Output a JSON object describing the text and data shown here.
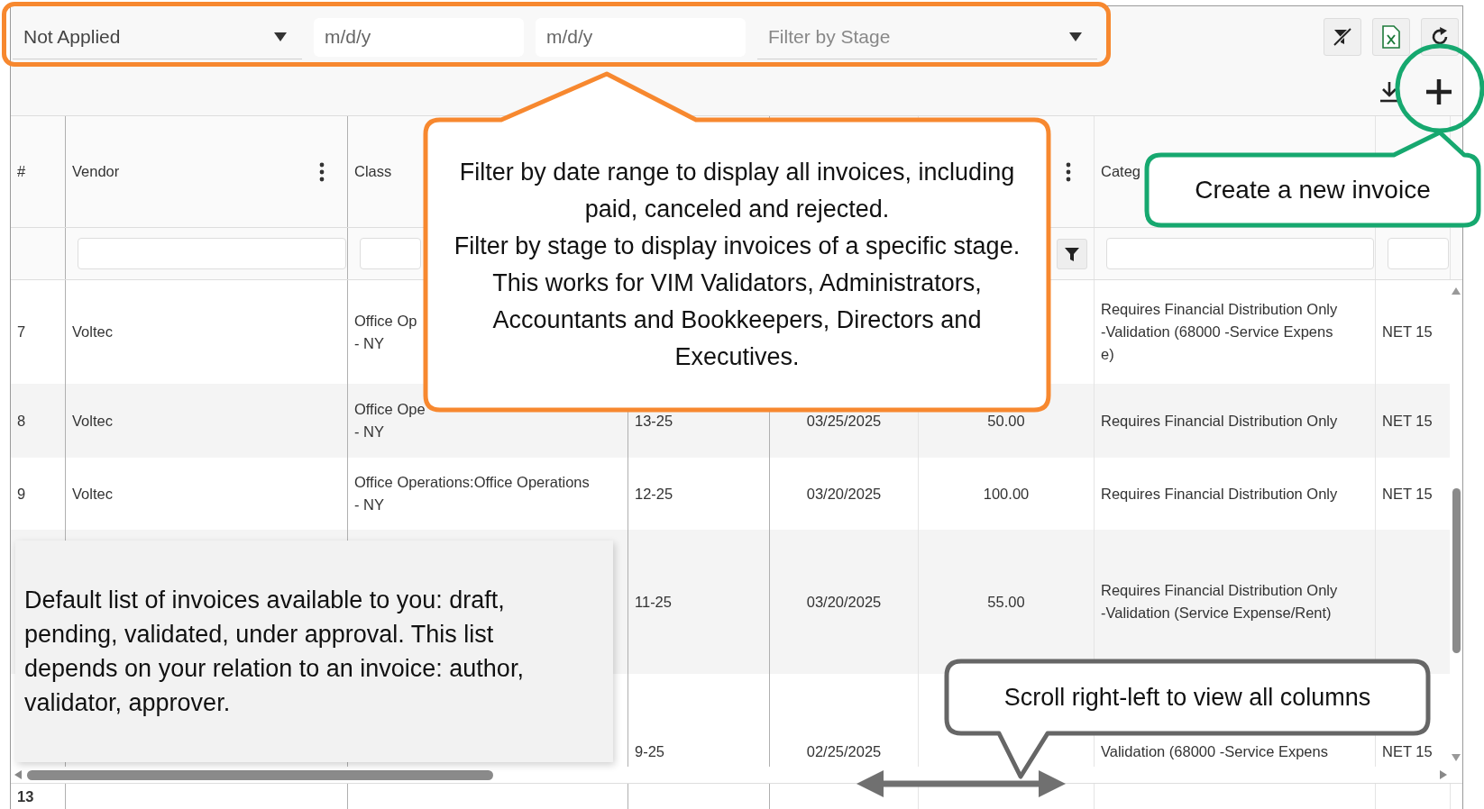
{
  "toolbar": {
    "stage_select": {
      "value": "Not Applied"
    },
    "date_from": {
      "placeholder": "m/d/y"
    },
    "date_to": {
      "placeholder": "m/d/y"
    },
    "stage_filter": {
      "placeholder": "Filter by Stage"
    },
    "buttons": [
      {
        "kind": "clear_filter"
      },
      {
        "kind": "excel"
      },
      {
        "kind": "refresh"
      }
    ],
    "actions": [
      {
        "kind": "download"
      },
      {
        "kind": "add"
      }
    ]
  },
  "table": {
    "columns": [
      {
        "label": "#",
        "menu": false,
        "filter_field": false
      },
      {
        "label": "Vendor",
        "menu": true,
        "filter_field": true
      },
      {
        "label": "Class",
        "filter_field": true
      },
      {},
      {},
      {
        "menu": true,
        "filter_button": true
      },
      {
        "label": "Categ",
        "menu": false,
        "filter_field": true
      },
      {
        "filter_field": true
      }
    ],
    "rows": [
      {
        "cells": [
          "7",
          "Voltec",
          "Office Op\n- NY",
          null,
          null,
          null,
          "Requires Financial Distribution Only\n-Validation (68000 -Service Expens\ne)",
          "NET 15"
        ]
      },
      {
        "cells": [
          "8",
          "Voltec",
          "Office Ope\n- NY",
          "13-25",
          "03/25/2025",
          "50.00",
          "Requires Financial Distribution Only",
          "NET 15"
        ]
      },
      {
        "cells": [
          "9",
          "Voltec",
          "Office Operations:Office Operations\n- NY",
          "12-25",
          "03/20/2025",
          "100.00",
          "Requires Financial Distribution Only",
          "NET 15"
        ]
      },
      {
        "cells": [
          null,
          null,
          null,
          "11-25",
          "03/20/2025",
          "55.00",
          "Requires Financial Distribution Only\n-Validation (Service Expense/Rent)",
          null
        ]
      },
      {
        "cells": [
          null,
          null,
          null,
          "9-25",
          "02/25/2025",
          null,
          "Validation (68000 -Service Expens",
          "NET 15"
        ]
      }
    ],
    "footer": {
      "count": "13"
    }
  },
  "annotations": [
    {
      "kind": "outline",
      "color": "#f7882f"
    },
    {
      "kind": "callout",
      "color": "#f7882f",
      "text": "Filter by date range to display all invoices, including paid, canceled and rejected.\nFilter by stage to display invoices of a specific stage.\nThis works for VIM Validators, Administrators, Accountants and Bookkeepers, Directors and Executives."
    },
    {
      "kind": "circle",
      "color": "#16a86f"
    },
    {
      "kind": "callout",
      "color": "#16a86f",
      "text": "Create a new invoice"
    },
    {
      "kind": "note",
      "text": "Default list of invoices available to you: draft, pending, validated, under approval. This list depends on your relation to an invoice: author, validator, approver."
    },
    {
      "kind": "callout",
      "color": "#666666",
      "text": "Scroll right-left to view all columns"
    },
    {
      "kind": "double_arrow",
      "color": "#707070"
    }
  ]
}
